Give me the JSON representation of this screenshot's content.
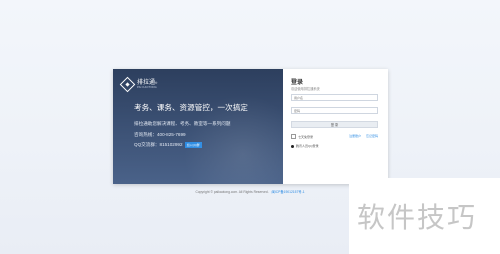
{
  "brand": {
    "name": "排拉通",
    "sub": "PAI KAOTONG",
    "reg": "®"
  },
  "promo": {
    "headline": "考务、课务、资源管控，一次搞定",
    "line1": "排拉通助您解决课程、考务、教室等一系列问题",
    "line2": "咨询热线：400-825-7699",
    "line3_prefix": "QQ交流群：815102992",
    "qq_badge": "加入QQ群"
  },
  "login": {
    "title": "登录",
    "subtitle": "欢迎使用排拉通系统",
    "username_placeholder": "用户名",
    "password_placeholder": "密码",
    "submit_label": "登 录",
    "remember_label": "七天免登录",
    "register_link": "注册账户",
    "forgot_link": "忘记密码",
    "qq_login_label": "腾讯人员QQ登录"
  },
  "footer": {
    "copyright": "Copyright © paikaotong.com. All Rights Reserved.",
    "icp": "闽ICP备19012157号-1"
  },
  "watermark": {
    "text": "软件技巧"
  }
}
